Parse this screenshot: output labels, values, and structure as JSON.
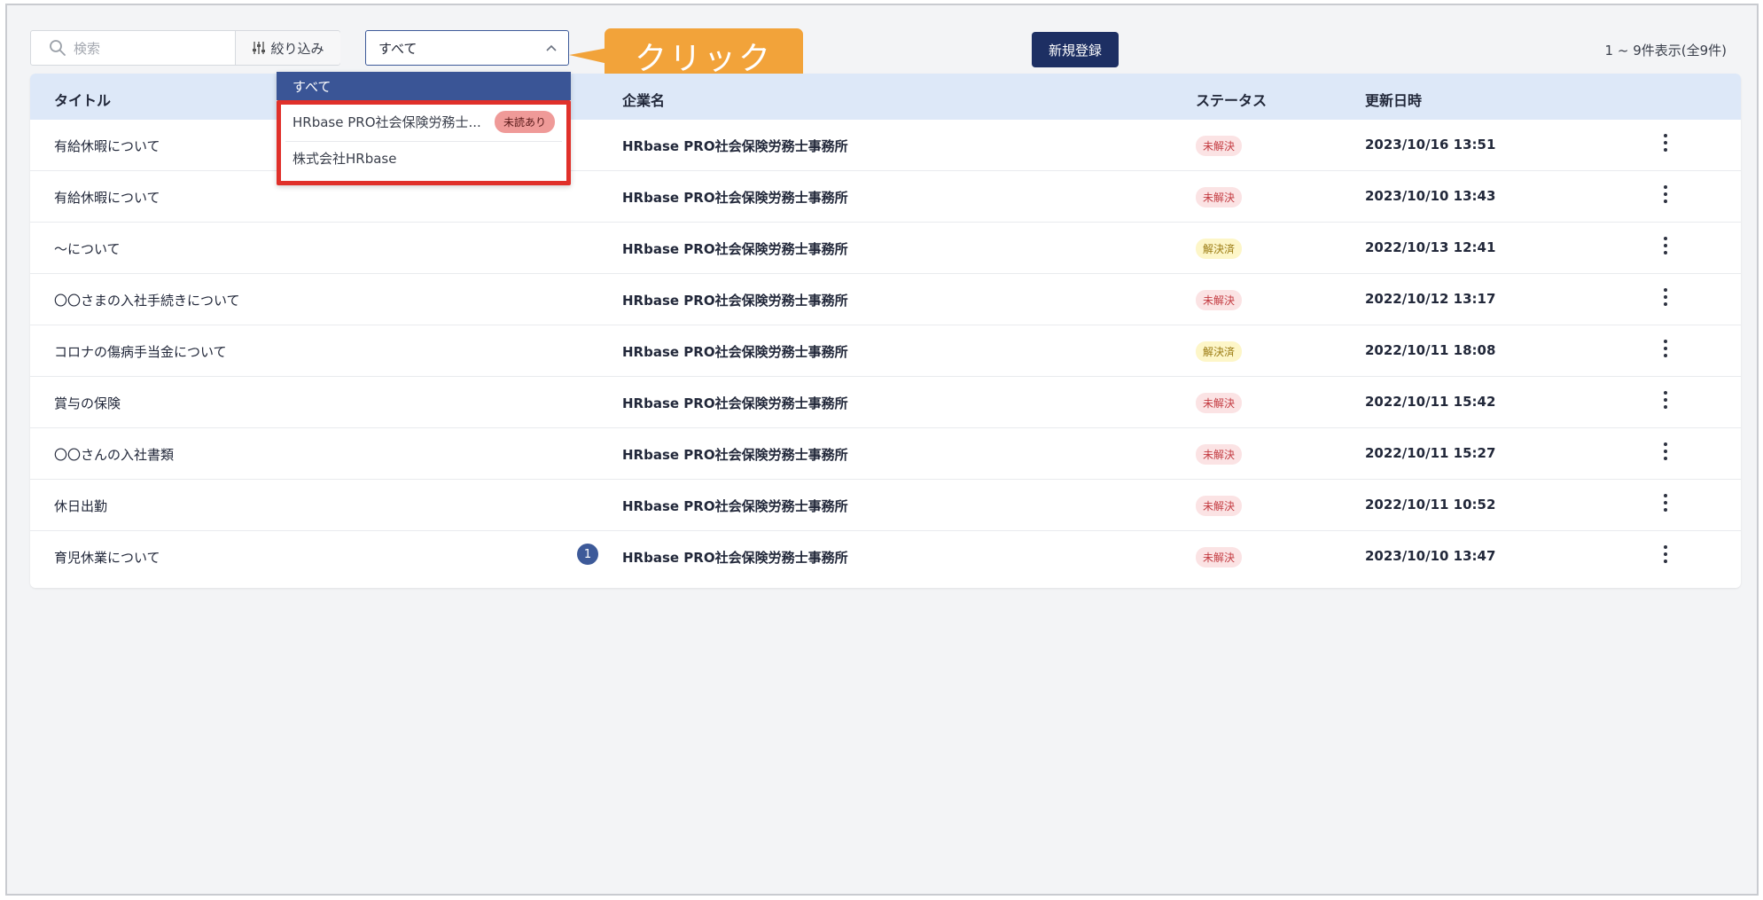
{
  "toolbar": {
    "search_placeholder": "検索",
    "filter_label": "絞り込み",
    "select_value": "すべて",
    "callout_text": "クリック",
    "new_button_label": "新規登録",
    "count_text": "1 ~ 9件表示(全9件)"
  },
  "dropdown": {
    "header": "すべて",
    "items": [
      {
        "label": "HRbase PRO社会保険労務士...",
        "badge": "未読あり"
      },
      {
        "label": "株式会社HRbase"
      }
    ]
  },
  "table": {
    "headers": {
      "title": "タイトル",
      "company": "企業名",
      "status": "ステータス",
      "updated": "更新日時"
    },
    "rows": [
      {
        "title": "有給休暇について",
        "company": "HRbase PRO社会保険労務士事務所",
        "status": "未解決",
        "status_color": "#c33a40",
        "updated": "2023/10/16 13:51"
      },
      {
        "title": "有給休暇について",
        "company": "HRbase PRO社会保険労務士事務所",
        "status": "未解決",
        "status_color": "#c33a40",
        "updated": "2023/10/10 13:43"
      },
      {
        "title": "〜について",
        "company": "HRbase PRO社会保険労務士事務所",
        "status": "解決済",
        "status_color": "#9a7a10",
        "updated": "2022/10/13 12:41"
      },
      {
        "title": "〇〇さまの入社手続きについて",
        "company": "HRbase PRO社会保険労務士事務所",
        "status": "未解決",
        "status_color": "#c33a40",
        "updated": "2022/10/12 13:17"
      },
      {
        "title": "コロナの傷病手当金について",
        "company": "HRbase PRO社会保険労務士事務所",
        "status": "解決済",
        "status_color": "#9a7a10",
        "updated": "2022/10/11 18:08"
      },
      {
        "title": "賞与の保険",
        "company": "HRbase PRO社会保険労務士事務所",
        "status": "未解決",
        "status_color": "#c33a40",
        "updated": "2022/10/11 15:42"
      },
      {
        "title": "〇〇さんの入社書類",
        "company": "HRbase PRO社会保険労務士事務所",
        "status": "未解決",
        "status_color": "#c33a40",
        "updated": "2022/10/11 15:27"
      },
      {
        "title": "休日出勤",
        "company": "HRbase PRO社会保険労務士事務所",
        "status": "未解決",
        "status_color": "#c33a40",
        "updated": "2022/10/11 10:52"
      },
      {
        "title": "育児休業について",
        "company": "HRbase PRO社会保険労務士事務所",
        "status": "未解決",
        "status_color": "#c33a40",
        "updated": "2023/10/10 13:47",
        "unread_count": "1"
      }
    ]
  },
  "colors": {
    "primary": "#1d2f63",
    "select_border": "#3d5a99",
    "callout": "#f2a33a",
    "highlight_border": "#e0302a",
    "table_header_bg": "#dde8f8"
  }
}
